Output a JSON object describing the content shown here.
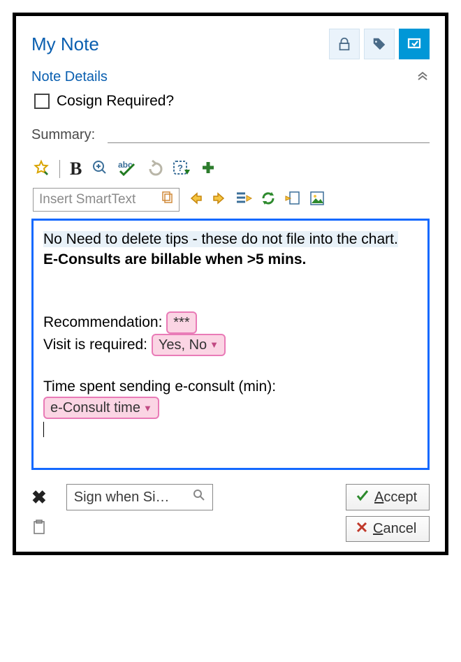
{
  "header": {
    "title": "My Note"
  },
  "details": {
    "title": "Note Details",
    "cosign_label": "Cosign Required?"
  },
  "summary": {
    "label": "Summary:",
    "value": ""
  },
  "smarttext": {
    "placeholder": "Insert SmartText"
  },
  "editor": {
    "tip_line": "No Need to delete tips - these do not file into the chart.",
    "billable_line": "E-Consults are billable when >5 mins.",
    "recommendation_label": "Recommendation:",
    "recommendation_field": "***",
    "visit_label": "Visit is required:",
    "visit_field": "Yes, No",
    "time_label": "Time spent sending e-consult (min):",
    "time_field": "e-Consult time"
  },
  "footer": {
    "sign_placeholder": "Sign when Si…",
    "accept": "ccept",
    "cancel": "ancel"
  },
  "colors": {
    "link": "#0a5fb0",
    "smart_bg": "#fbd5e4",
    "smart_border": "#e97bb7",
    "editor_border": "#1469ff"
  }
}
